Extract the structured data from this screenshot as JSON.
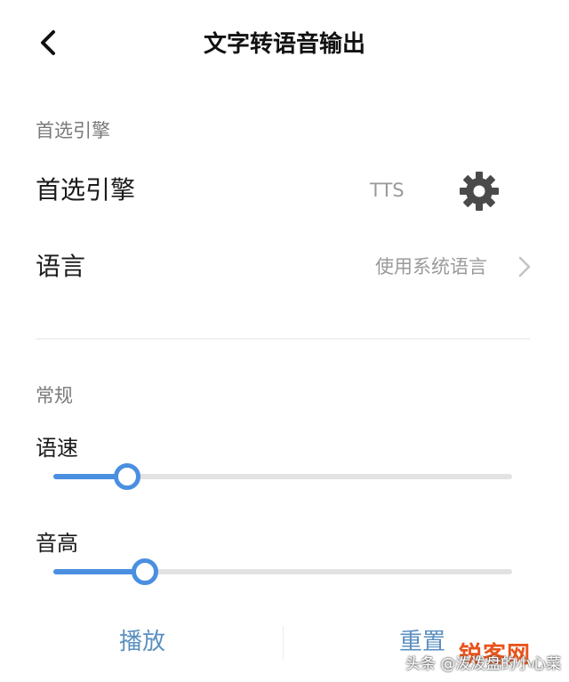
{
  "header": {
    "title": "文字转语音输出",
    "back_icon": "chevron-left-icon"
  },
  "engine_section": {
    "title": "首选引擎",
    "preferred_engine": {
      "label": "首选引擎",
      "value": "TTS",
      "settings_icon": "gear-icon"
    },
    "language": {
      "label": "语言",
      "value": "使用系统语言",
      "icon": "chevron-right-icon"
    }
  },
  "general_section": {
    "title": "常规",
    "speech_rate": {
      "label": "语速",
      "value_fraction": 0.16
    },
    "pitch": {
      "label": "音高",
      "value_fraction": 0.2
    }
  },
  "footer": {
    "play_label": "播放",
    "reset_label": "重置"
  },
  "watermark": {
    "text": "头条 @泼泼盘的小心菜",
    "logo": "锐客网"
  },
  "colors": {
    "accent": "#4a8fe0",
    "footer_button": "#5b8fc0",
    "secondary_text": "#9a9a9a",
    "track": "#e2e2e2"
  }
}
